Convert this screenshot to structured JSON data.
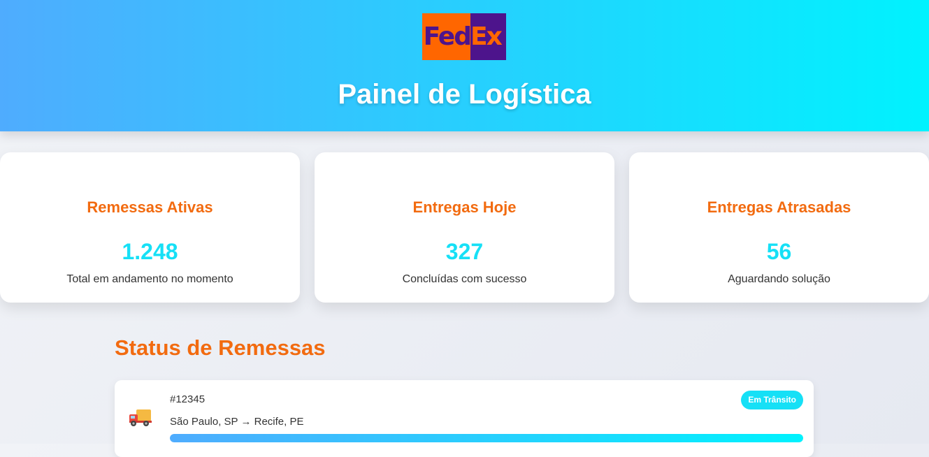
{
  "header": {
    "logo_left": "Fed",
    "logo_right": "Ex",
    "title": "Painel de Logística"
  },
  "cards": [
    {
      "title": "Remessas Ativas",
      "value": "1.248",
      "description": "Total em andamento no momento"
    },
    {
      "title": "Entregas Hoje",
      "value": "327",
      "description": "Concluídas com sucesso"
    },
    {
      "title": "Entregas Atrasadas",
      "value": "56",
      "description": "Aguardando solução"
    }
  ],
  "shipments_section": {
    "title": "Status de Remessas",
    "items": [
      {
        "icon": "truck-icon",
        "id": "#12345",
        "route": "São Paulo, SP → Recife, PE",
        "status": "Em Trânsito",
        "progress": 1.0
      }
    ]
  },
  "colors": {
    "accent_orange": "#f26b10",
    "accent_cyan": "#16e0f6",
    "header_gradient_start": "#4facfe",
    "header_gradient_end": "#00f2fe",
    "fedex_purple": "#4d148c",
    "fedex_orange": "#ff6600"
  }
}
